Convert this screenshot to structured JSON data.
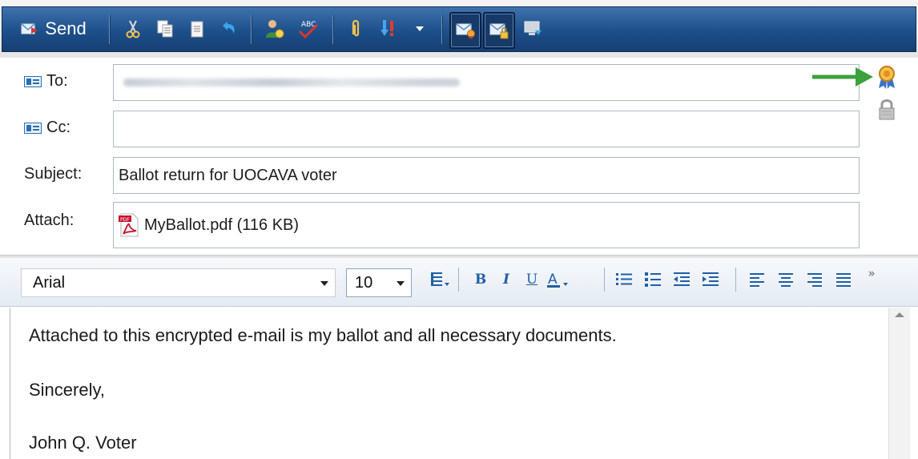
{
  "toolbar": {
    "send_label": "Send",
    "icons": [
      "send-icon",
      "cut-icon",
      "copy-icon",
      "paste-icon",
      "undo-icon",
      "address-book-icon",
      "spell-check-icon",
      "attach-icon",
      "priority-icon",
      "dropdown-arrow-icon",
      "sign-message-icon",
      "encrypt-message-icon",
      "offline-icon"
    ],
    "spellcheck_text": "ABC"
  },
  "header": {
    "to_label": "To:",
    "cc_label": "Cc:",
    "subject_label": "Subject:",
    "attach_label": "Attach:",
    "cc_value": "",
    "subject_value": "Ballot return for UOCAVA voter",
    "attachment": {
      "name": "MyBallot.pdf (116 KB)",
      "icon": "pdf-file-icon",
      "pdf_badge": "PDF"
    },
    "security_icons": [
      "digital-signature-ribbon-icon",
      "lock-icon"
    ],
    "annotation_arrow_color": "#3ca13c"
  },
  "format_bar": {
    "font_name": "Arial",
    "font_size": "10",
    "bold": "B",
    "italic": "I",
    "underline": "U",
    "font_color": "A",
    "more": "»"
  },
  "body": {
    "lines": [
      "Attached to this encrypted e-mail is my ballot and all necessary documents.",
      "Sincerely,",
      "John Q. Voter"
    ]
  },
  "colors": {
    "toolbar_blue": "#1d4f8a",
    "accent_blue": "#1f5fa8",
    "arrow_green": "#3ca13c"
  }
}
